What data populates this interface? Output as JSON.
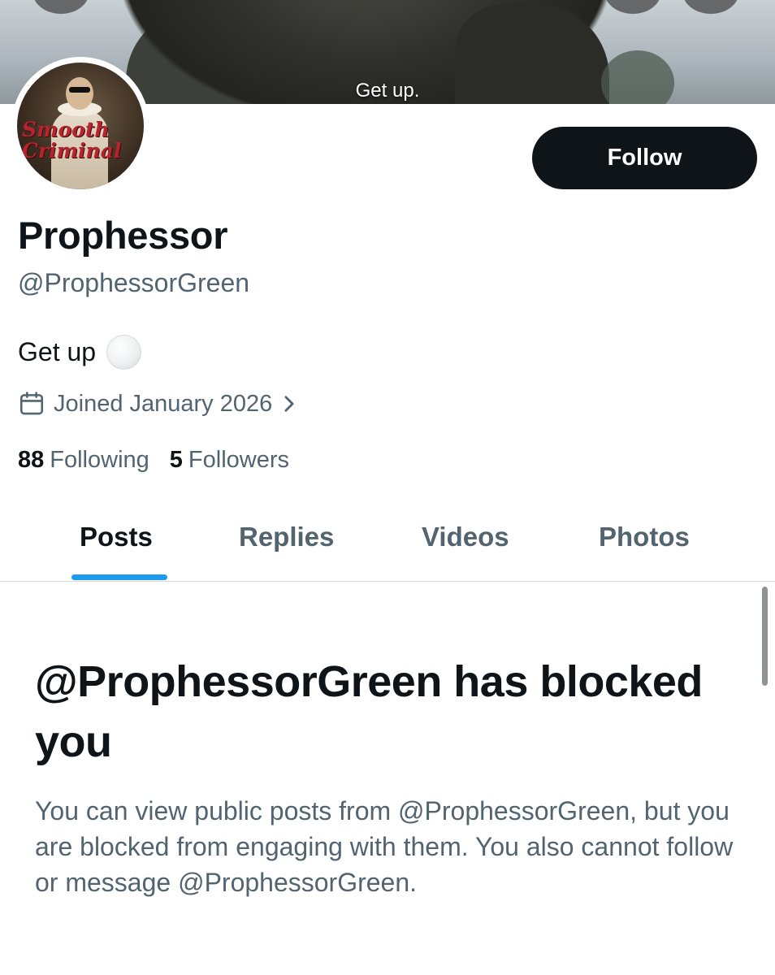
{
  "banner": {
    "caption": "Get up."
  },
  "profile": {
    "avatar_art_text": "Smooth Criminal",
    "follow_label": "Follow",
    "display_name": "Prophessor",
    "handle": "@ProphessorGreen",
    "bio": "Get up",
    "bio_emoji_icon": "white-circle-icon",
    "joined": "Joined January 2026",
    "following_count": "88",
    "following_label": "Following",
    "followers_count": "5",
    "followers_label": "Followers"
  },
  "tabs": [
    {
      "label": "Posts",
      "active": true
    },
    {
      "label": "Replies",
      "active": false
    },
    {
      "label": "Videos",
      "active": false
    },
    {
      "label": "Photos",
      "active": false
    }
  ],
  "blocked": {
    "title": "@ProphessorGreen has blocked you",
    "description": "You can view public posts from @ProphessorGreen, but you are blocked from engaging with them. You also cannot follow or message @ProphessorGreen."
  },
  "colors": {
    "accent": "#1d9bf0",
    "primary_text": "#0f1419",
    "secondary_text": "#536471",
    "follow_button_bg": "#0f1419"
  }
}
